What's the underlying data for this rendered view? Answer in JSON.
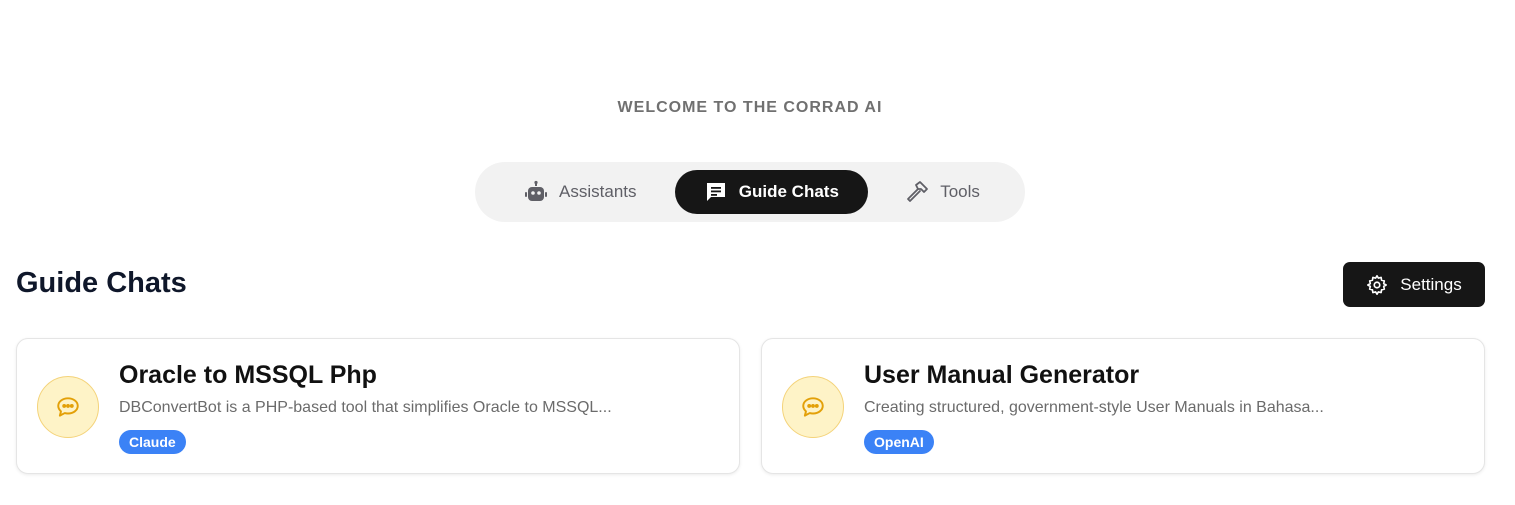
{
  "header": {
    "welcome": "WELCOME TO THE CORRAD AI"
  },
  "tabs": [
    {
      "label": "Assistants",
      "icon": "robot-icon",
      "active": false
    },
    {
      "label": "Guide Chats",
      "icon": "message-square-icon",
      "active": true
    },
    {
      "label": "Tools",
      "icon": "hammer-icon",
      "active": false
    }
  ],
  "section": {
    "title": "Guide Chats",
    "settings_label": "Settings"
  },
  "cards": [
    {
      "title": "Oracle to MSSQL Php",
      "description": "DBConvertBot is a PHP-based tool that simplifies Oracle to MSSQL...",
      "badge": "Claude",
      "icon": "chat-bubble-icon"
    },
    {
      "title": "User Manual Generator",
      "description": "Creating structured, government-style User Manuals in Bahasa...",
      "badge": "OpenAI",
      "icon": "chat-bubble-icon"
    }
  ],
  "colors": {
    "dark": "#161616",
    "badge": "#3b82f6",
    "icon_bg": "#fef3c7",
    "icon_fg": "#e3a008"
  }
}
